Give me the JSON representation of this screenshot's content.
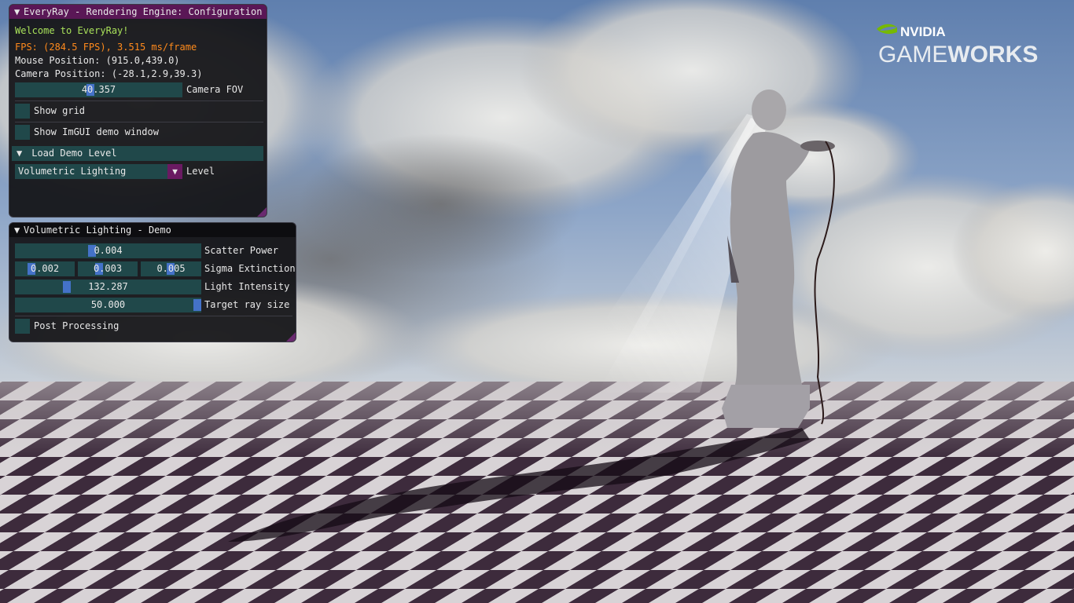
{
  "config_window": {
    "title": "EveryRay - Rendering Engine: Configuration",
    "welcome": "Welcome to EveryRay!",
    "fps": "FPS: (284.5 FPS), 3.515 ms/frame",
    "mouse_position": "Mouse Position: (915.0,439.0)",
    "camera_position": "Camera Position: (-28.1,2.9,39.3)",
    "camera_fov_value": "40.357",
    "camera_fov_label": "Camera FOV",
    "camera_fov_fraction": 0.45,
    "show_grid_label": "Show grid",
    "show_imgui_demo_label": "Show ImGUI demo window",
    "load_demo_level_header": "Load Demo Level",
    "level_combo_value": "Volumetric Lighting",
    "level_label": "Level"
  },
  "demo_window": {
    "title": "Volumetric Lighting - Demo",
    "scatter_power_value": "0.004",
    "scatter_power_label": "Scatter Power",
    "scatter_power_fraction": 0.41,
    "sigma_extinction_values": [
      "0.002",
      "0.003",
      "0.005"
    ],
    "sigma_extinction_fractions": [
      0.24,
      0.34,
      0.49
    ],
    "sigma_extinction_label": "Sigma Extinction",
    "light_intensity_value": "132.287",
    "light_intensity_label": "Light Intensity",
    "light_intensity_fraction": 0.27,
    "target_ray_size_value": "50.000",
    "target_ray_size_label": "Target ray size",
    "target_ray_size_fraction": 1.0,
    "post_processing_label": "Post Processing"
  },
  "logo": {
    "brand": "NVIDIA",
    "product_light": "GAME",
    "product_bold": "WORKS"
  },
  "colors": {
    "title_active": "#5a1756",
    "frame_bg": "#20484a",
    "slider_grab": "#4472c8",
    "fps_text": "#ff8a1c",
    "welcome_text": "#a8e05a",
    "nvidia_green": "#76b900"
  }
}
